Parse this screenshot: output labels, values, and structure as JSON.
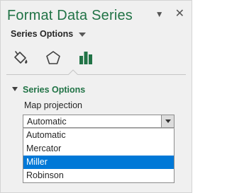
{
  "header": {
    "title": "Format Data Series",
    "collapse_glyph": "▼",
    "close_glyph": "✕"
  },
  "series_options_menu": {
    "label": "Series Options"
  },
  "tabs": [
    {
      "icon": "paint-bucket-icon"
    },
    {
      "icon": "pentagon-icon"
    },
    {
      "icon": "bar-chart-icon",
      "active": true
    }
  ],
  "section": {
    "title": "Series Options",
    "field_label": "Map projection",
    "select_value": "Automatic",
    "options": [
      "Automatic",
      "Mercator",
      "Miller",
      "Robinson"
    ],
    "highlighted_index": 2
  },
  "colors": {
    "accent": "#217346",
    "selection": "#0078d7"
  }
}
